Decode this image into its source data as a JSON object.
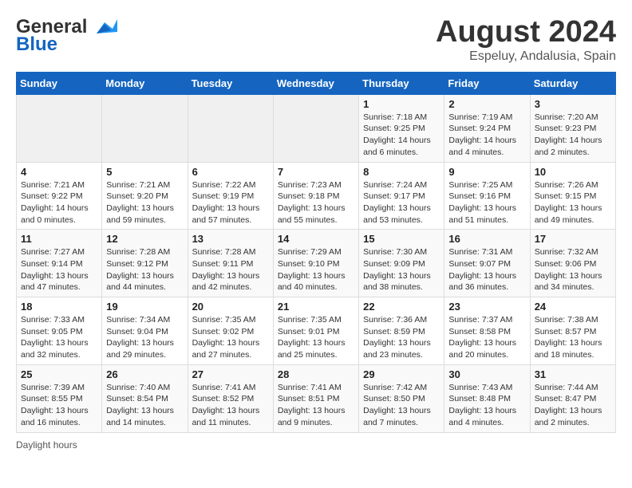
{
  "header": {
    "logo_line1": "General",
    "logo_line2": "Blue",
    "main_title": "August 2024",
    "subtitle": "Espeluy, Andalusia, Spain"
  },
  "calendar": {
    "days_of_week": [
      "Sunday",
      "Monday",
      "Tuesday",
      "Wednesday",
      "Thursday",
      "Friday",
      "Saturday"
    ],
    "weeks": [
      [
        {
          "day": "",
          "info": ""
        },
        {
          "day": "",
          "info": ""
        },
        {
          "day": "",
          "info": ""
        },
        {
          "day": "",
          "info": ""
        },
        {
          "day": "1",
          "info": "Sunrise: 7:18 AM\nSunset: 9:25 PM\nDaylight: 14 hours and 6 minutes."
        },
        {
          "day": "2",
          "info": "Sunrise: 7:19 AM\nSunset: 9:24 PM\nDaylight: 14 hours and 4 minutes."
        },
        {
          "day": "3",
          "info": "Sunrise: 7:20 AM\nSunset: 9:23 PM\nDaylight: 14 hours and 2 minutes."
        }
      ],
      [
        {
          "day": "4",
          "info": "Sunrise: 7:21 AM\nSunset: 9:22 PM\nDaylight: 14 hours and 0 minutes."
        },
        {
          "day": "5",
          "info": "Sunrise: 7:21 AM\nSunset: 9:20 PM\nDaylight: 13 hours and 59 minutes."
        },
        {
          "day": "6",
          "info": "Sunrise: 7:22 AM\nSunset: 9:19 PM\nDaylight: 13 hours and 57 minutes."
        },
        {
          "day": "7",
          "info": "Sunrise: 7:23 AM\nSunset: 9:18 PM\nDaylight: 13 hours and 55 minutes."
        },
        {
          "day": "8",
          "info": "Sunrise: 7:24 AM\nSunset: 9:17 PM\nDaylight: 13 hours and 53 minutes."
        },
        {
          "day": "9",
          "info": "Sunrise: 7:25 AM\nSunset: 9:16 PM\nDaylight: 13 hours and 51 minutes."
        },
        {
          "day": "10",
          "info": "Sunrise: 7:26 AM\nSunset: 9:15 PM\nDaylight: 13 hours and 49 minutes."
        }
      ],
      [
        {
          "day": "11",
          "info": "Sunrise: 7:27 AM\nSunset: 9:14 PM\nDaylight: 13 hours and 47 minutes."
        },
        {
          "day": "12",
          "info": "Sunrise: 7:28 AM\nSunset: 9:12 PM\nDaylight: 13 hours and 44 minutes."
        },
        {
          "day": "13",
          "info": "Sunrise: 7:28 AM\nSunset: 9:11 PM\nDaylight: 13 hours and 42 minutes."
        },
        {
          "day": "14",
          "info": "Sunrise: 7:29 AM\nSunset: 9:10 PM\nDaylight: 13 hours and 40 minutes."
        },
        {
          "day": "15",
          "info": "Sunrise: 7:30 AM\nSunset: 9:09 PM\nDaylight: 13 hours and 38 minutes."
        },
        {
          "day": "16",
          "info": "Sunrise: 7:31 AM\nSunset: 9:07 PM\nDaylight: 13 hours and 36 minutes."
        },
        {
          "day": "17",
          "info": "Sunrise: 7:32 AM\nSunset: 9:06 PM\nDaylight: 13 hours and 34 minutes."
        }
      ],
      [
        {
          "day": "18",
          "info": "Sunrise: 7:33 AM\nSunset: 9:05 PM\nDaylight: 13 hours and 32 minutes."
        },
        {
          "day": "19",
          "info": "Sunrise: 7:34 AM\nSunset: 9:04 PM\nDaylight: 13 hours and 29 minutes."
        },
        {
          "day": "20",
          "info": "Sunrise: 7:35 AM\nSunset: 9:02 PM\nDaylight: 13 hours and 27 minutes."
        },
        {
          "day": "21",
          "info": "Sunrise: 7:35 AM\nSunset: 9:01 PM\nDaylight: 13 hours and 25 minutes."
        },
        {
          "day": "22",
          "info": "Sunrise: 7:36 AM\nSunset: 8:59 PM\nDaylight: 13 hours and 23 minutes."
        },
        {
          "day": "23",
          "info": "Sunrise: 7:37 AM\nSunset: 8:58 PM\nDaylight: 13 hours and 20 minutes."
        },
        {
          "day": "24",
          "info": "Sunrise: 7:38 AM\nSunset: 8:57 PM\nDaylight: 13 hours and 18 minutes."
        }
      ],
      [
        {
          "day": "25",
          "info": "Sunrise: 7:39 AM\nSunset: 8:55 PM\nDaylight: 13 hours and 16 minutes."
        },
        {
          "day": "26",
          "info": "Sunrise: 7:40 AM\nSunset: 8:54 PM\nDaylight: 13 hours and 14 minutes."
        },
        {
          "day": "27",
          "info": "Sunrise: 7:41 AM\nSunset: 8:52 PM\nDaylight: 13 hours and 11 minutes."
        },
        {
          "day": "28",
          "info": "Sunrise: 7:41 AM\nSunset: 8:51 PM\nDaylight: 13 hours and 9 minutes."
        },
        {
          "day": "29",
          "info": "Sunrise: 7:42 AM\nSunset: 8:50 PM\nDaylight: 13 hours and 7 minutes."
        },
        {
          "day": "30",
          "info": "Sunrise: 7:43 AM\nSunset: 8:48 PM\nDaylight: 13 hours and 4 minutes."
        },
        {
          "day": "31",
          "info": "Sunrise: 7:44 AM\nSunset: 8:47 PM\nDaylight: 13 hours and 2 minutes."
        }
      ]
    ]
  },
  "footer": {
    "note": "Daylight hours"
  }
}
